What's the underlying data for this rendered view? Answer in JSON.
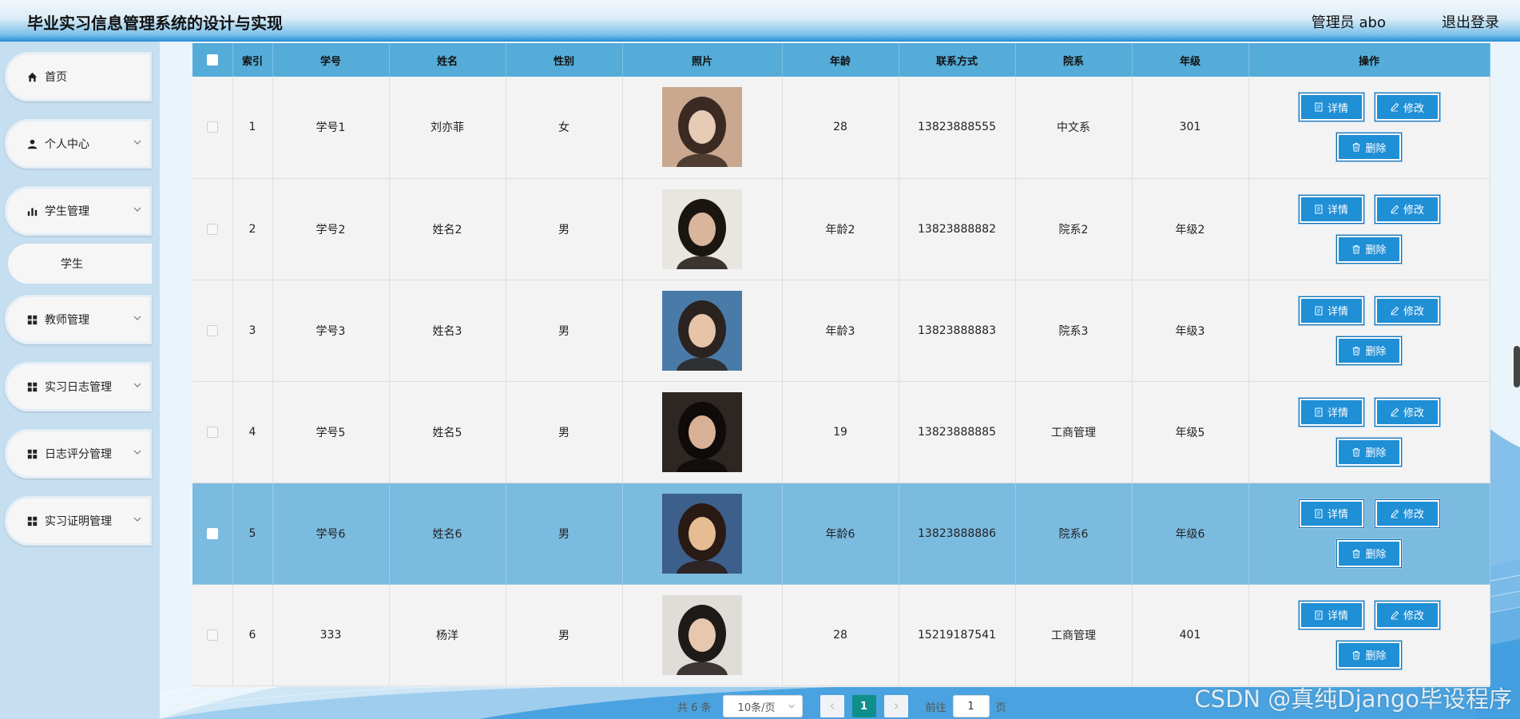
{
  "header": {
    "title": "毕业实习信息管理系统的设计与实现",
    "admin": "管理员 abo",
    "logout": "退出登录"
  },
  "sidebar": {
    "items": [
      {
        "label": "首页",
        "icon": "home-icon"
      },
      {
        "label": "个人中心",
        "icon": "user-icon"
      },
      {
        "label": "学生管理",
        "icon": "bar-chart-icon"
      },
      {
        "label": "学生",
        "icon": ""
      },
      {
        "label": "教师管理",
        "icon": "grid-icon"
      },
      {
        "label": "实习日志管理",
        "icon": "grid-icon"
      },
      {
        "label": "日志评分管理",
        "icon": "grid-icon"
      },
      {
        "label": "实习证明管理",
        "icon": "grid-icon"
      }
    ]
  },
  "table": {
    "headers": [
      "索引",
      "学号",
      "姓名",
      "性别",
      "照片",
      "年龄",
      "联系方式",
      "院系",
      "年级",
      "操作"
    ],
    "rows": [
      {
        "index": "1",
        "student_no": "学号1",
        "name": "刘亦菲",
        "gender": "女",
        "age": "28",
        "phone": "13823888555",
        "dept": "中文系",
        "grade": "301"
      },
      {
        "index": "2",
        "student_no": "学号2",
        "name": "姓名2",
        "gender": "男",
        "age": "年龄2",
        "phone": "13823888882",
        "dept": "院系2",
        "grade": "年级2"
      },
      {
        "index": "3",
        "student_no": "学号3",
        "name": "姓名3",
        "gender": "男",
        "age": "年龄3",
        "phone": "13823888883",
        "dept": "院系3",
        "grade": "年级3"
      },
      {
        "index": "4",
        "student_no": "学号5",
        "name": "姓名5",
        "gender": "男",
        "age": "19",
        "phone": "13823888885",
        "dept": "工商管理",
        "grade": "年级5"
      },
      {
        "index": "5",
        "student_no": "学号6",
        "name": "姓名6",
        "gender": "男",
        "age": "年龄6",
        "phone": "13823888886",
        "dept": "院系6",
        "grade": "年级6"
      },
      {
        "index": "6",
        "student_no": "333",
        "name": "杨洋",
        "gender": "男",
        "age": "28",
        "phone": "15219187541",
        "dept": "工商管理",
        "grade": "401"
      }
    ],
    "actions": {
      "detail": "详情",
      "edit": "修改",
      "delete": "删除"
    }
  },
  "pagination": {
    "total": "共 6 条",
    "page_size": "10条/页",
    "current_page": "1",
    "goto_label": "前往",
    "goto_value": "1",
    "goto_unit": "页"
  },
  "watermark": "CSDN @真纯Django毕设程序",
  "colors": {
    "header_row": "#55acd8",
    "highlight_row": "#7bbbe0",
    "button": "#1f8fd6",
    "sidebar": "#c5def0",
    "current_page": "#0e8f8b"
  }
}
